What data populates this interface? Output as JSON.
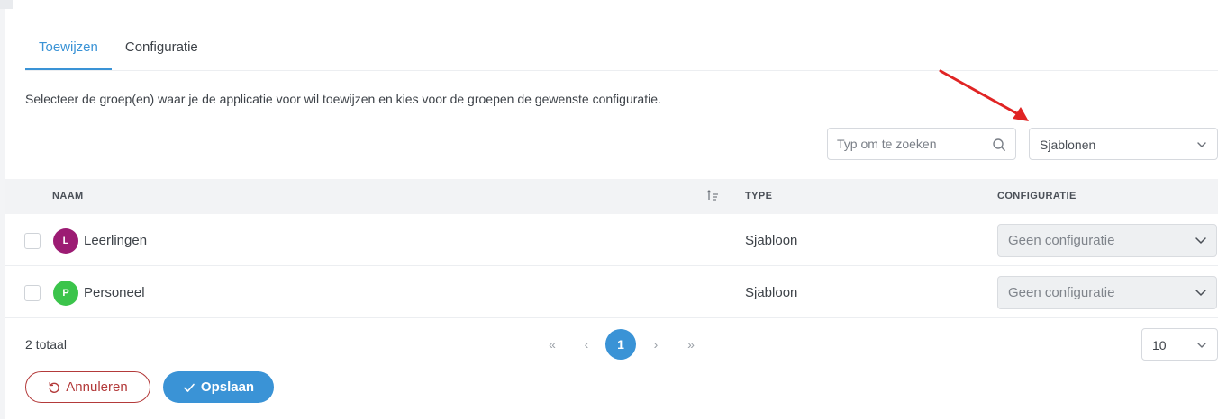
{
  "tabs": [
    {
      "label": "Toewijzen",
      "active": true
    },
    {
      "label": "Configuratie",
      "active": false
    }
  ],
  "description": "Selecteer de groep(en) waar je de applicatie voor wil toewijzen en kies voor de groepen de gewenste configuratie.",
  "search": {
    "placeholder": "Typ om te zoeken",
    "icon": "search-icon"
  },
  "filter": {
    "value": "Sjablonen",
    "icon": "chevron-down-icon"
  },
  "annotation": {
    "color": "#e02424",
    "icon": "red-arrow"
  },
  "table": {
    "headers": {
      "name": "NAAM",
      "type": "TYPE",
      "config": "CONFIGURATIE"
    },
    "rows": [
      {
        "initial": "L",
        "avatar_color": "#9c1b73",
        "name": "Leerlingen",
        "type": "Sjabloon",
        "config": "Geen configuratie"
      },
      {
        "initial": "P",
        "avatar_color": "#3bc44b",
        "name": "Personeel",
        "type": "Sjabloon",
        "config": "Geen configuratie"
      }
    ]
  },
  "footer": {
    "total": "2 totaal",
    "pagination": {
      "first": "«",
      "prev": "‹",
      "current": "1",
      "next": "›",
      "last": "»"
    },
    "page_size": "10"
  },
  "actions": {
    "cancel": "Annuleren",
    "save": "Opslaan"
  },
  "colors": {
    "accent": "#3a93d6",
    "danger": "#b33a3a"
  }
}
